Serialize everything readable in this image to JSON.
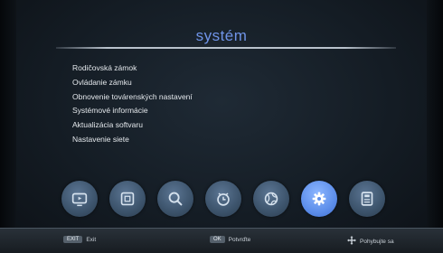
{
  "title": "systém",
  "menu": [
    {
      "label": "Rodičovská zámok"
    },
    {
      "label": "Ovládanie zámku"
    },
    {
      "label": "Obnovenie továrenských nastavení"
    },
    {
      "label": "Systémové informácie"
    },
    {
      "label": "Aktualizácia softvaru"
    },
    {
      "label": "Nastavenie siete"
    }
  ],
  "icons": [
    {
      "name": "tv-icon"
    },
    {
      "name": "picture-icon"
    },
    {
      "name": "search-icon"
    },
    {
      "name": "clock-icon"
    },
    {
      "name": "globe-icon"
    },
    {
      "name": "gear-icon",
      "active": true
    },
    {
      "name": "storage-icon"
    }
  ],
  "hints": {
    "exit_key": "EXIT",
    "exit_label": "Exit",
    "ok_key": "OK",
    "ok_label": "Potvrďte",
    "move_label": "Pohybujte sa"
  },
  "colors": {
    "title": "#6f94e8",
    "active_icon": "#5d8eea",
    "icon": "#3c536b"
  }
}
